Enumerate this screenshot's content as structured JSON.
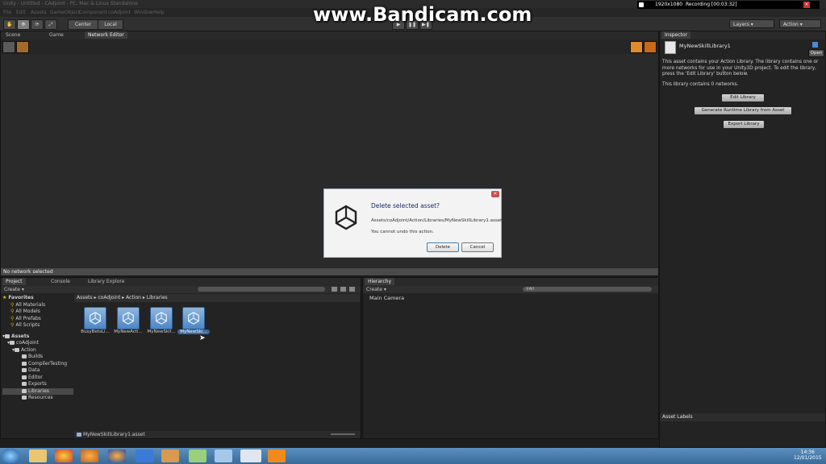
{
  "window": {
    "title": "Unity - Untitled - CAdjoint - PC, Mac & Linux Standalone"
  },
  "menu": [
    "File",
    "Edit",
    "Assets",
    "GameObject",
    "Component",
    "coAdjoint",
    "Window",
    "Help"
  ],
  "toolbar": {
    "pivot_center": "Center",
    "pivot_local": "Local",
    "layers_label": "Layers",
    "layout_label": "Action"
  },
  "overlay": {
    "watermark": "www.Bandicam.com",
    "resolution": "1920x1080",
    "recording": "Recording [00:03:32]"
  },
  "scene_tabs": [
    "Scene",
    "Game",
    "Network Editor"
  ],
  "network_status": "No network selected",
  "inspector": {
    "tab": "Inspector",
    "asset_name": "MyNewSkillLibrary1",
    "open_label": "Open",
    "description": "This asset contains your Action Library. The library contains one or more networks for use in your Unity3D project. To edit the library, press the 'Edit Library' button below.",
    "network_count": "This library contains 0 networks.",
    "buttons": [
      "Edit Library",
      "Generate Runtime Library from Asset",
      "Export Library"
    ],
    "asset_labels": "Asset Labels"
  },
  "project": {
    "tabs": [
      "Project",
      "Console",
      "Library Explore"
    ],
    "create_label": "Create",
    "favorites_label": "Favorites",
    "favorites": [
      "All Materials",
      "All Models",
      "All Prefabs",
      "All Scripts"
    ],
    "assets_label": "Assets",
    "tree": {
      "coadjoint": "coAdjoint",
      "action": "Action",
      "children": [
        "Builds",
        "CompilerTesting",
        "Data",
        "Editor",
        "Exports",
        "Libraries",
        "Resources"
      ]
    },
    "breadcrumb": [
      "Assets",
      "coAdjoint",
      "Action",
      "Libraries"
    ],
    "assets": [
      "BusyBetsLi...",
      "MyNewActi...",
      "MyNewSkil...",
      "MyNewSki..."
    ],
    "status_file": "MyNewSkillLibrary1.asset"
  },
  "hierarchy": {
    "tab": "Hierarchy",
    "create_label": "Create",
    "search_placeholder": "All",
    "items": [
      "Main Camera"
    ]
  },
  "dialog": {
    "title": "Delete selected asset?",
    "path": "Assets/coAdjoint/Action/Libraries/MyNewSkillLibrary1.asset",
    "warning": "You cannot undo this action.",
    "delete_label": "Delete",
    "cancel_label": "Cancel"
  },
  "clock": {
    "time": "14:36",
    "date": "12/01/2015"
  },
  "colors": {
    "accent": "#3a72b0",
    "panel": "#232323",
    "selection": "#3d6aa0"
  }
}
